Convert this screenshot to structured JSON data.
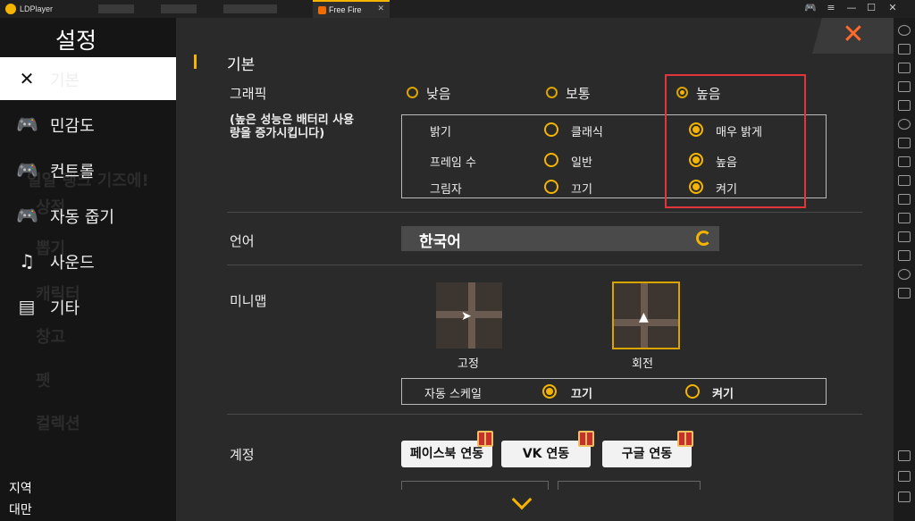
{
  "titlebar": {
    "app_name": "LDPlayer",
    "tab_title": "Free Fire",
    "tab_close": "✕",
    "controls": [
      "🎮",
      "≡",
      "—",
      "☐",
      "✕"
    ]
  },
  "sidebar": {
    "title": "설정",
    "items": [
      {
        "label": "기본",
        "icon": "wrench-screwdriver-icon"
      },
      {
        "label": "민감도",
        "icon": "gamepad-icon"
      },
      {
        "label": "컨트롤",
        "icon": "gamepad-icon"
      },
      {
        "label": "자동 줍기",
        "icon": "gamepad-icon"
      },
      {
        "label": "사운드",
        "icon": "music-note-icon"
      },
      {
        "label": "기타",
        "icon": "document-icon"
      }
    ],
    "background_items": [
      "일일 랭크 기즈에!",
      "상점",
      "뽑기",
      "캐릭터",
      "창고",
      "펫",
      "컬렉션"
    ],
    "region_label": "지역",
    "region_value": "대만"
  },
  "settings": {
    "section_title": "기본",
    "graphics": {
      "label": "그래픽",
      "note": "(높은 성능은 배터리 사용량을 증가시킵니다)",
      "options": [
        "낮음",
        "보통",
        "높음"
      ],
      "selected": "높음",
      "rows": [
        {
          "label": "밝기",
          "opt_a": "클래식",
          "opt_b": "매우 밝게",
          "selected": "매우 밝게"
        },
        {
          "label": "프레임 수",
          "opt_a": "일반",
          "opt_b": "높음",
          "selected": "높음"
        },
        {
          "label": "그림자",
          "opt_a": "끄기",
          "opt_b": "켜기",
          "selected": "켜기"
        }
      ]
    },
    "language": {
      "label": "언어",
      "value": "한국어"
    },
    "minimap": {
      "label": "미니맵",
      "options": [
        "고정",
        "회전"
      ],
      "selected": "회전",
      "auto_scale": {
        "label": "자동 스케일",
        "opt_a": "끄기",
        "opt_b": "켜기",
        "selected": "끄기"
      }
    },
    "account": {
      "label": "계정",
      "buttons": [
        "페이스북 연동",
        "VK 연동",
        "구글 연동"
      ]
    }
  },
  "colors": {
    "accent": "#f5b400",
    "highlight_box": "#e0353a",
    "close_x": "#ff6a2a"
  }
}
